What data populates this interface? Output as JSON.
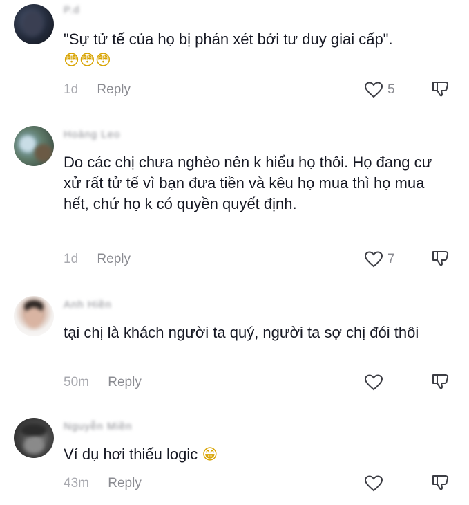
{
  "comments": [
    {
      "username": "P.d",
      "text": "\"Sự tử tế của họ bị phán xét bởi tư duy giai cấp\".",
      "emoji": "😳😳😳",
      "time": "1d",
      "reply": "Reply",
      "likes": "5"
    },
    {
      "username": "Hoàng Leo",
      "text": "Do các chị chưa nghèo nên k hiểu họ thôi. Họ đang cư xử rất tử tế vì bạn đưa tiền và kêu họ mua thì họ mua hết, chứ họ k có quyền quyết định.",
      "time": "1d",
      "reply": "Reply",
      "likes": "7"
    },
    {
      "username": "Anh Hiền",
      "text": "tại chị là khách người ta quý, người ta sợ chị đói thôi",
      "time": "50m",
      "reply": "Reply"
    },
    {
      "username": "Nguyễn Miền",
      "text": "Ví dụ hơi thiếu logic",
      "emoji": "😁",
      "time": "43m",
      "reply": "Reply"
    }
  ]
}
